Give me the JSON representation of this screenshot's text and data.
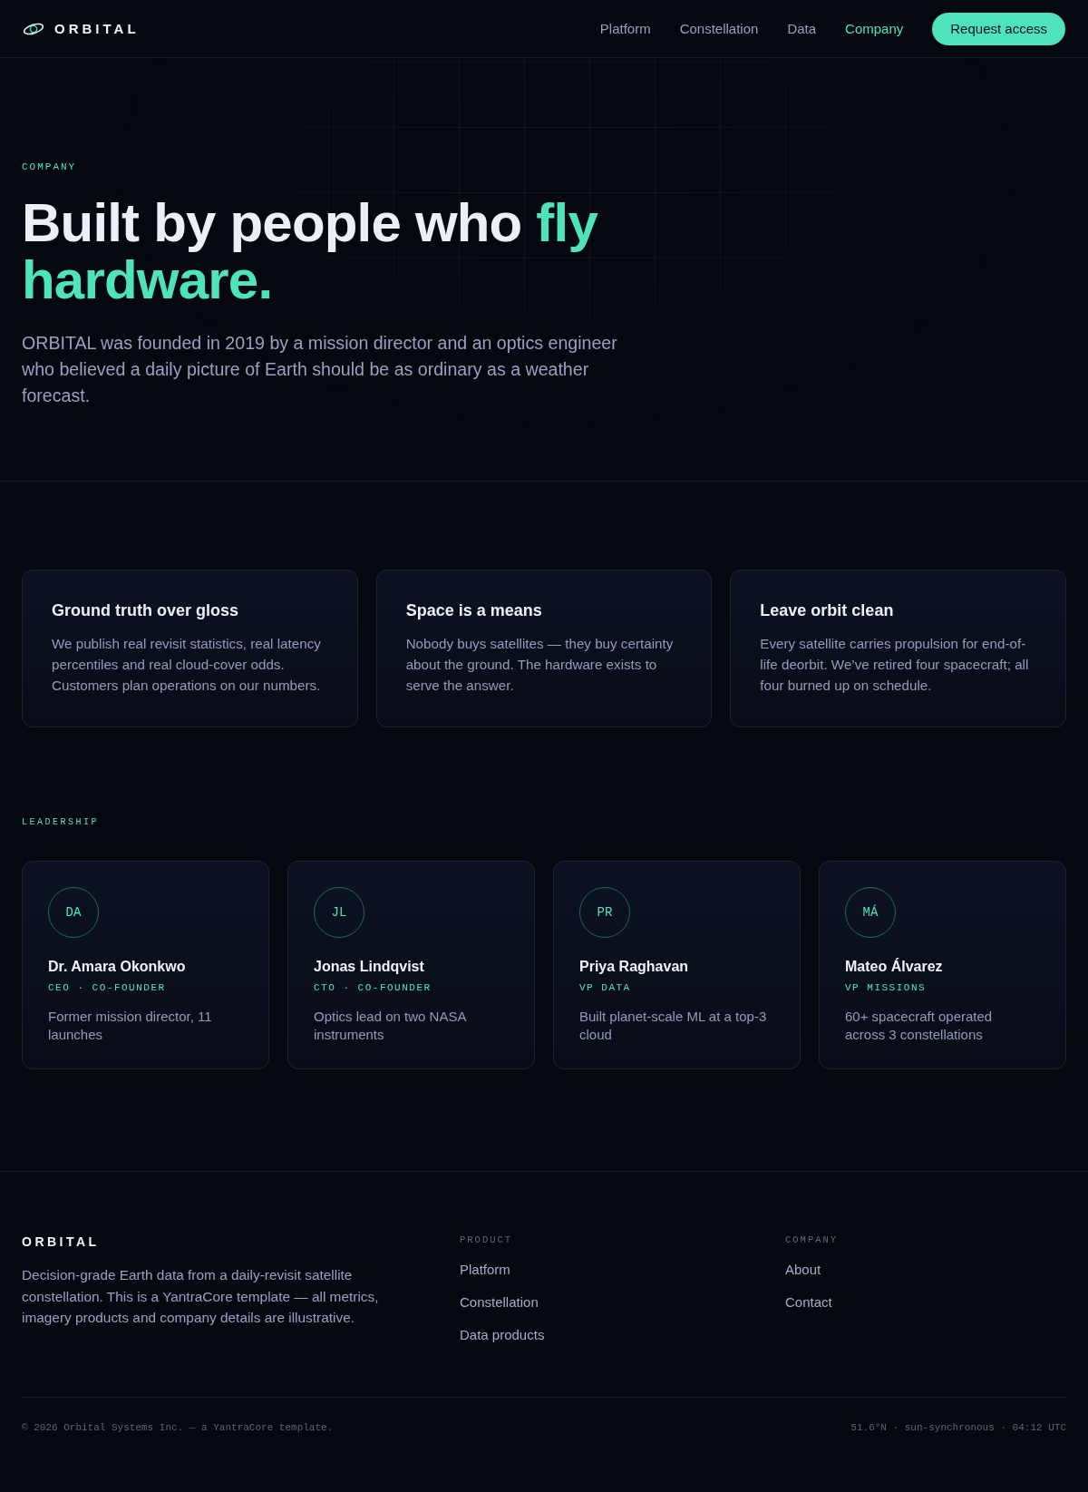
{
  "header": {
    "logo": "ORBITAL",
    "nav": [
      {
        "label": "Platform",
        "selected": false
      },
      {
        "label": "Constellation",
        "selected": false
      },
      {
        "label": "Data",
        "selected": false
      },
      {
        "label": "Company",
        "selected": true
      }
    ],
    "cta": "Request access"
  },
  "hero": {
    "eyebrow": "COMPANY",
    "title": "Built by people who ",
    "title_accent": "fly hardware.",
    "intro": "ORBITAL was founded in 2019 by a mission director and an optics engineer who believed a daily picture of Earth should be as ordinary as a weather forecast."
  },
  "values": [
    {
      "title": "Ground truth over gloss",
      "body": "We publish real revisit statistics, real latency percentiles and real cloud-cover odds. Customers plan operations on our numbers."
    },
    {
      "title": "Space is a means",
      "body": "Nobody buys satellites — they buy certainty about the ground. The hardware exists to serve the answer."
    },
    {
      "title": "Leave orbit clean",
      "body": "Every satellite carries propulsion for end-of-life deorbit. We’ve retired four spacecraft; all four burned up on schedule."
    }
  ],
  "leadership": {
    "label": "LEADERSHIP",
    "people": [
      {
        "initials": "DA",
        "name": "Dr. Amara Okonkwo",
        "role": "CEO · CO-FOUNDER",
        "bio": "Former mission director, 11 launches"
      },
      {
        "initials": "JL",
        "name": "Jonas Lindqvist",
        "role": "CTO · CO-FOUNDER",
        "bio": "Optics lead on two NASA instruments"
      },
      {
        "initials": "PR",
        "name": "Priya Raghavan",
        "role": "VP DATA",
        "bio": "Built planet-scale ML at a top-3 cloud"
      },
      {
        "initials": "MÁ",
        "name": "Mateo Álvarez",
        "role": "VP MISSIONS",
        "bio": "60+ spacecraft operated across 3 constellations"
      }
    ]
  },
  "footer": {
    "logo": "ORBITAL",
    "description": "Decision-grade Earth data from a daily-revisit satellite constellation. This is a YantraCore template — all metrics, imagery products and company details are illustrative.",
    "columns": [
      {
        "heading": "PRODUCT",
        "links": [
          "Platform",
          "Constellation",
          "Data products"
        ]
      },
      {
        "heading": "COMPANY",
        "links": [
          "About",
          "Contact"
        ]
      }
    ],
    "copyright": "© 2026 Orbital Systems Inc. — a YantraCore template.",
    "meta": "51.6°N · sun-synchronous · 04:12 UTC"
  }
}
